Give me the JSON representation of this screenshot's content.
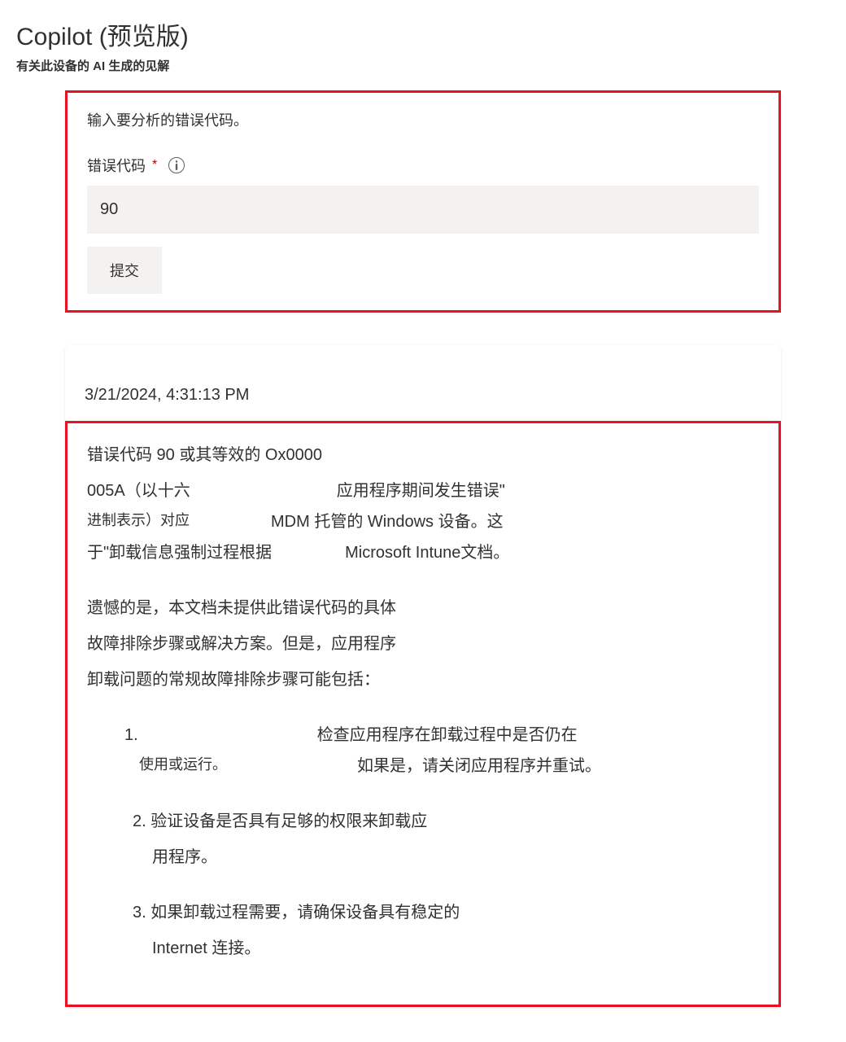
{
  "header": {
    "title": "Copilot (预览版)",
    "subtitle": "有关此设备的 AI 生成的见解"
  },
  "form": {
    "prompt": "输入要分析的错误代码。",
    "label": "错误代码",
    "required_marker": "*",
    "value": "90",
    "submit_label": "提交"
  },
  "response": {
    "timestamp": "3/21/2024, 4:31:13 PM",
    "line1": "错误代码 90 或其等效的 Ox0000",
    "line2a": "005A（以十六",
    "line2b": "应用程序期间发生错误\"",
    "line3a": "进制表示）对应",
    "line3b": "MDM 托管的 Windows 设备。这",
    "line4a": "于\"卸载信息强制过程根据",
    "line4b": "Microsoft Intune文档。",
    "para2_l1": "遗憾的是，本文档未提供此错误代码的具体",
    "para2_l2": "故障排除步骤或解决方案。但是，应用程序",
    "para2_l3": "卸载问题的常规故障排除步骤可能包括：",
    "step1_num": "1.",
    "step1_ra": "检查应用程序在卸载过程中是否仍在",
    "step1_rb_a": "使用或运行。",
    "step1_rb_b": "如果是，请关闭应用程序并重试。",
    "step2_l1": "2. 验证设备是否具有足够的权限来卸载应",
    "step2_l2": "用程序。",
    "step3_l1": "3. 如果卸载过程需要，请确保设备具有稳定的",
    "step3_l2": "Internet 连接。"
  }
}
